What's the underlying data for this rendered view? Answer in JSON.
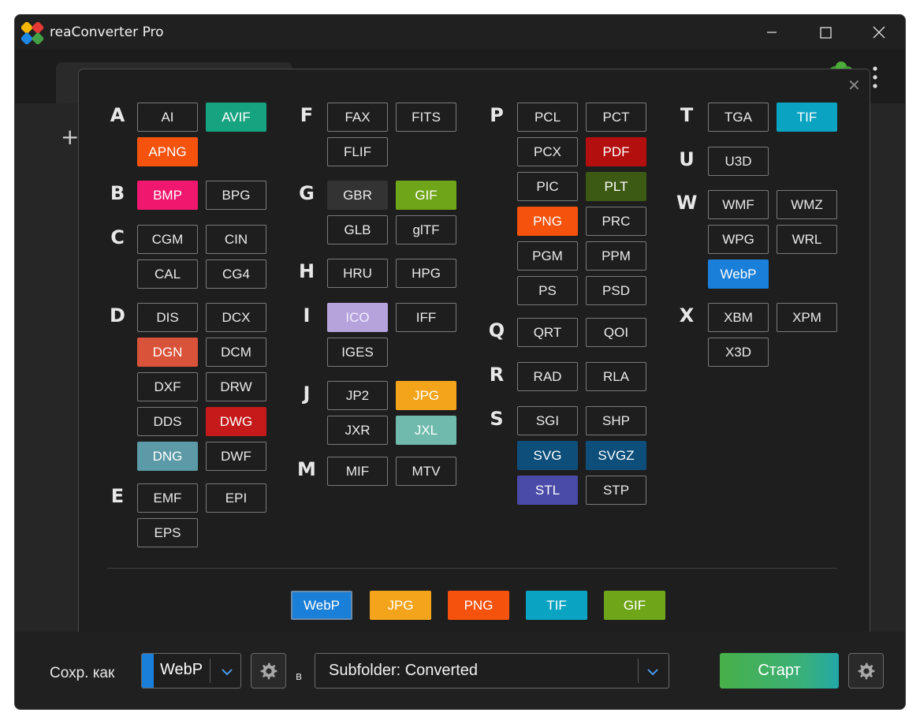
{
  "titlebar": {
    "app_title": "reaConverter Pro"
  },
  "popup": {
    "groups": [
      {
        "letter": "A",
        "formats": [
          {
            "label": "AI"
          },
          {
            "label": "AVIF",
            "color": "#16a37f"
          },
          {
            "label": "APNG",
            "color": "#f5520d"
          }
        ]
      },
      {
        "letter": "B",
        "formats": [
          {
            "label": "BMP",
            "color": "#f0176e"
          },
          {
            "label": "BPG"
          }
        ]
      },
      {
        "letter": "C",
        "formats": [
          {
            "label": "CGM"
          },
          {
            "label": "CIN"
          },
          {
            "label": "CAL"
          },
          {
            "label": "CG4"
          }
        ]
      },
      {
        "letter": "D",
        "formats": [
          {
            "label": "DIS"
          },
          {
            "label": "DCX"
          },
          {
            "label": "DGN",
            "color": "#d9533a"
          },
          {
            "label": "DCM"
          },
          {
            "label": "DXF"
          },
          {
            "label": "DRW"
          },
          {
            "label": "DDS"
          },
          {
            "label": "DWG",
            "color": "#c41a1a"
          },
          {
            "label": "DNG",
            "color": "#5b9aa6"
          },
          {
            "label": "DWF"
          }
        ]
      },
      {
        "letter": "E",
        "formats": [
          {
            "label": "EMF"
          },
          {
            "label": "EPI"
          },
          {
            "label": "EPS"
          }
        ]
      },
      {
        "letter": "F",
        "formats": [
          {
            "label": "FAX"
          },
          {
            "label": "FITS"
          },
          {
            "label": "FLIF"
          }
        ]
      },
      {
        "letter": "G",
        "formats": [
          {
            "label": "GBR",
            "color": "#333333"
          },
          {
            "label": "GIF",
            "color": "#6fa519"
          },
          {
            "label": "GLB"
          },
          {
            "label": "glTF"
          }
        ]
      },
      {
        "letter": "H",
        "formats": [
          {
            "label": "HRU"
          },
          {
            "label": "HPG"
          }
        ]
      },
      {
        "letter": "I",
        "formats": [
          {
            "label": "ICO",
            "color": "#b6a3dc"
          },
          {
            "label": "IFF"
          },
          {
            "label": "IGES"
          }
        ]
      },
      {
        "letter": "J",
        "formats": [
          {
            "label": "JP2"
          },
          {
            "label": "JPG",
            "color": "#f4a41a"
          },
          {
            "label": "JXR"
          },
          {
            "label": "JXL",
            "color": "#6fb9ad"
          }
        ]
      },
      {
        "letter": "M",
        "formats": [
          {
            "label": "MIF"
          },
          {
            "label": "MTV"
          }
        ]
      },
      {
        "letter": "P",
        "formats": [
          {
            "label": "PCL"
          },
          {
            "label": "PCT"
          },
          {
            "label": "PCX"
          },
          {
            "label": "PDF",
            "color": "#b30f0f"
          },
          {
            "label": "PIC"
          },
          {
            "label": "PLT",
            "color": "#3d5a14"
          },
          {
            "label": "PNG",
            "color": "#f5520d"
          },
          {
            "label": "PRC"
          },
          {
            "label": "PGM"
          },
          {
            "label": "PPM"
          },
          {
            "label": "PS"
          },
          {
            "label": "PSD"
          }
        ]
      },
      {
        "letter": "Q",
        "formats": [
          {
            "label": "QRT"
          },
          {
            "label": "QOI"
          }
        ]
      },
      {
        "letter": "R",
        "formats": [
          {
            "label": "RAD"
          },
          {
            "label": "RLA"
          }
        ]
      },
      {
        "letter": "S",
        "formats": [
          {
            "label": "SGI"
          },
          {
            "label": "SHP"
          },
          {
            "label": "SVG",
            "color": "#0d4f7a"
          },
          {
            "label": "SVGZ",
            "color": "#0d4f7a"
          },
          {
            "label": "STL",
            "color": "#4a4aa8"
          },
          {
            "label": "STP"
          }
        ]
      },
      {
        "letter": "T",
        "formats": [
          {
            "label": "TGA"
          },
          {
            "label": "TIF",
            "color": "#0aa3c2"
          }
        ]
      },
      {
        "letter": "U",
        "formats": [
          {
            "label": "U3D"
          }
        ]
      },
      {
        "letter": "W",
        "formats": [
          {
            "label": "WMF"
          },
          {
            "label": "WMZ"
          },
          {
            "label": "WPG"
          },
          {
            "label": "WRL"
          },
          {
            "label": "WebP",
            "color": "#1a7fd8"
          }
        ]
      },
      {
        "letter": "X",
        "formats": [
          {
            "label": "XBM"
          },
          {
            "label": "XPM"
          },
          {
            "label": "X3D"
          }
        ]
      }
    ],
    "favorites": [
      {
        "label": "WebP",
        "color": "#1a7fd8",
        "selected": true
      },
      {
        "label": "JPG",
        "color": "#f4a41a"
      },
      {
        "label": "PNG",
        "color": "#f5520d"
      },
      {
        "label": "TIF",
        "color": "#0aa3c2"
      },
      {
        "label": "GIF",
        "color": "#6fa519"
      }
    ]
  },
  "bottombar": {
    "save_as_label": "Сохр. как",
    "selected_format": "WebP",
    "in_label": "в",
    "output_folder": "Subfolder: Converted",
    "start_label": "Старт"
  }
}
